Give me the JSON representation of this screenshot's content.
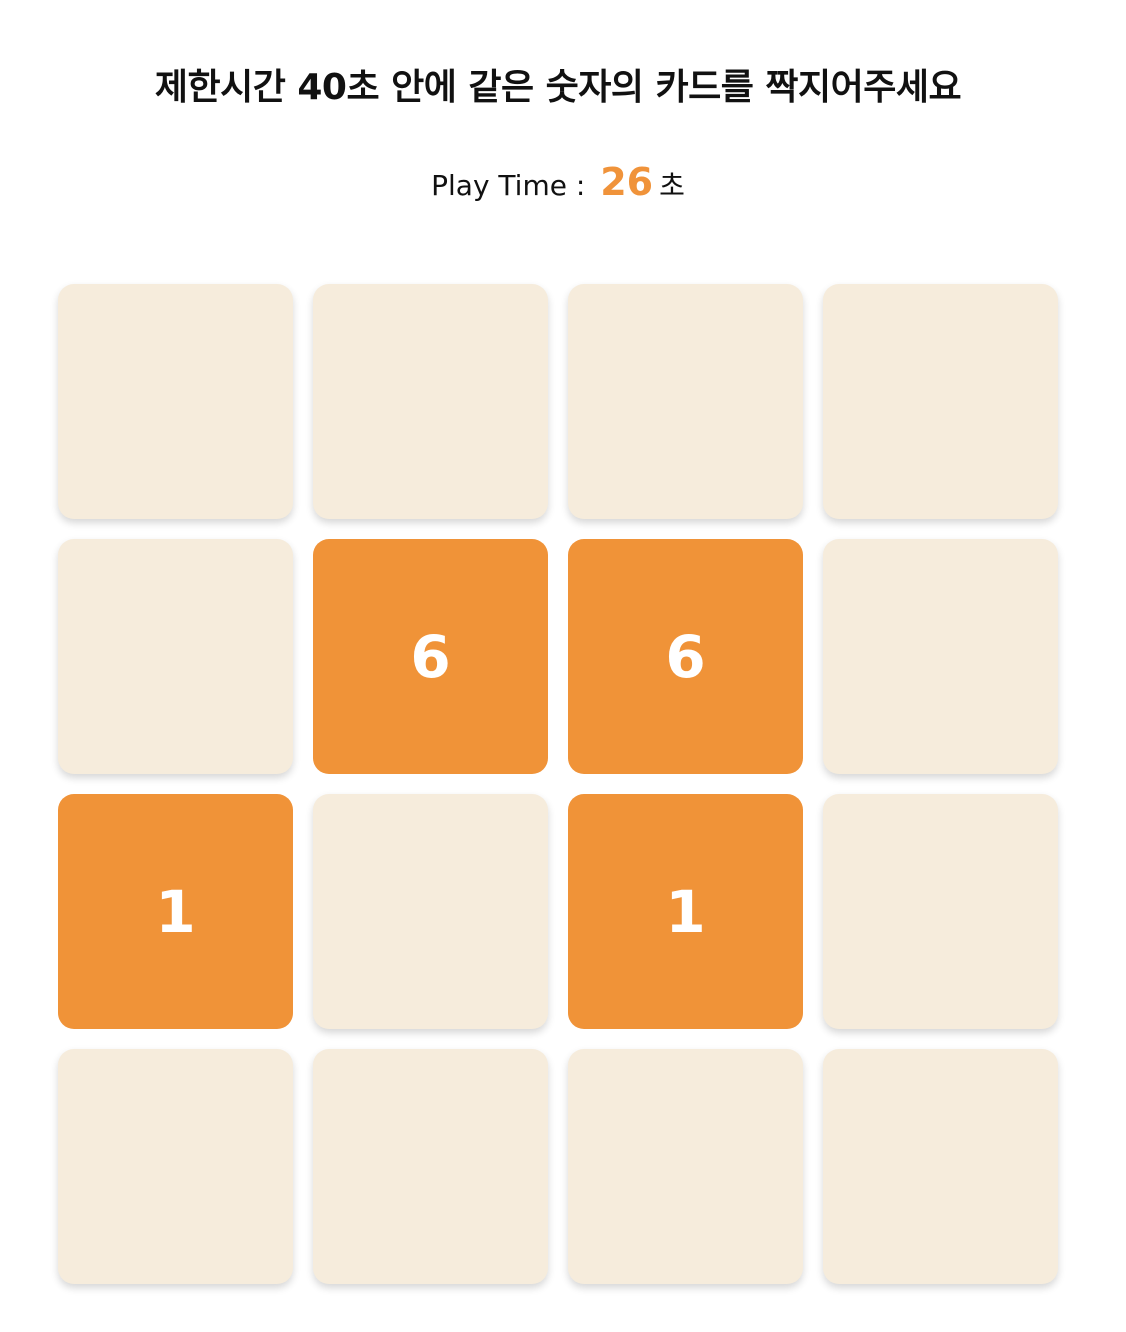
{
  "header": {
    "title": "제한시간 40초 안에 같은 숫자의 카드를 짝지어주세요"
  },
  "timer": {
    "label": "Play Time : ",
    "seconds": "26",
    "unit": "초"
  },
  "colors": {
    "card_back": "#f6ecdc",
    "card_open": "#f09338",
    "accent": "#f0933a"
  },
  "cards": [
    {
      "open": false,
      "value": ""
    },
    {
      "open": false,
      "value": ""
    },
    {
      "open": false,
      "value": ""
    },
    {
      "open": false,
      "value": ""
    },
    {
      "open": false,
      "value": ""
    },
    {
      "open": true,
      "value": "6"
    },
    {
      "open": true,
      "value": "6"
    },
    {
      "open": false,
      "value": ""
    },
    {
      "open": true,
      "value": "1"
    },
    {
      "open": false,
      "value": ""
    },
    {
      "open": true,
      "value": "1"
    },
    {
      "open": false,
      "value": ""
    },
    {
      "open": false,
      "value": ""
    },
    {
      "open": false,
      "value": ""
    },
    {
      "open": false,
      "value": ""
    },
    {
      "open": false,
      "value": ""
    }
  ]
}
